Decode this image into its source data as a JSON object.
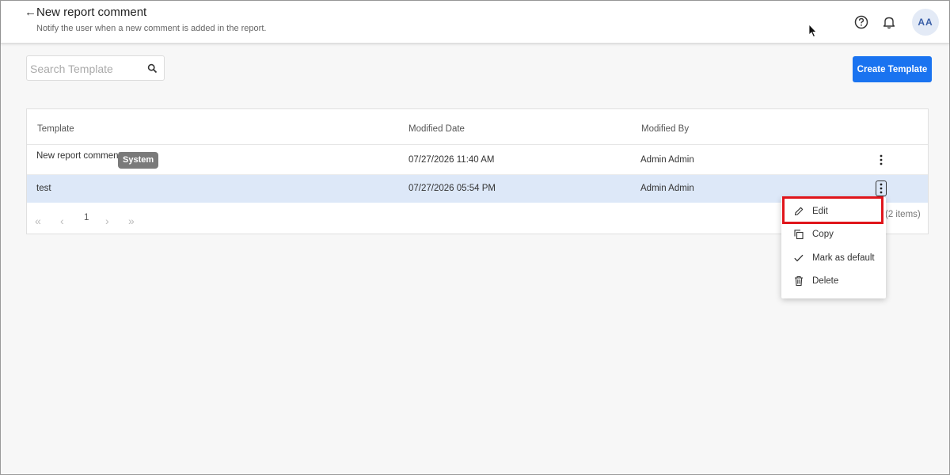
{
  "header": {
    "back_icon": "arrow-left-icon",
    "title": "New report comment",
    "subtitle": "Notify the user when a new comment is added in the report.",
    "avatar_initials": "AA"
  },
  "toolbar": {
    "search_placeholder": "Search Template",
    "create_label": "Create Template",
    "accent_color": "#1a73f0"
  },
  "table": {
    "columns": [
      "Template",
      "Modified Date",
      "Modified By"
    ],
    "rows": [
      {
        "template": "New report comment",
        "badge": "System",
        "modified_date": "07/27/2026 11:40 AM",
        "modified_by": "Admin Admin"
      },
      {
        "template": "test",
        "badge": "",
        "modified_date": "07/27/2026 05:54 PM",
        "modified_by": "Admin Admin"
      }
    ],
    "selected_row_color": "#dde8f8"
  },
  "pagination": {
    "current_page": "1",
    "items_text": "(2 items)"
  },
  "row_menu": {
    "items": [
      {
        "label": "Edit",
        "icon": "pencil-icon"
      },
      {
        "label": "Copy",
        "icon": "copy-icon"
      },
      {
        "label": "Mark as default",
        "icon": "check-icon"
      },
      {
        "label": "Delete",
        "icon": "trash-icon"
      }
    ],
    "highlight_color": "#e0151b"
  }
}
